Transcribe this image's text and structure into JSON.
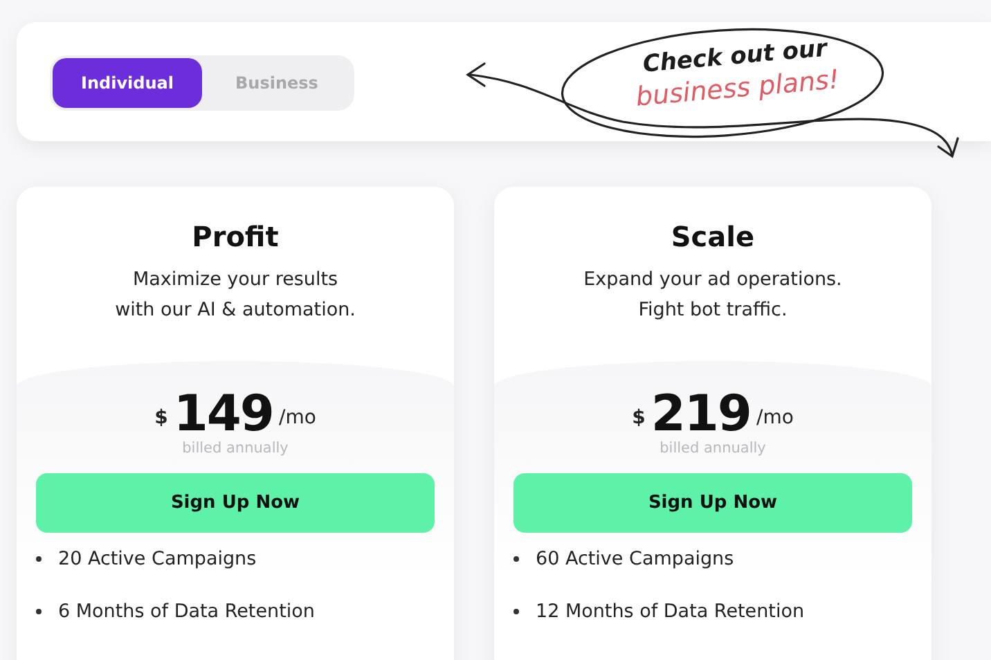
{
  "plan_toggle": [
    {
      "label": "Individual",
      "selected": true
    },
    {
      "label": "Business",
      "selected": false
    }
  ],
  "callout": {
    "line_1": "Check out our",
    "line_2": "business plans!"
  },
  "plans": [
    {
      "name": "Profit",
      "description": [
        "Maximize your results",
        "with our AI & automation."
      ],
      "currency": "$",
      "price": "149",
      "period": "/mo",
      "billing": "billed annually",
      "button": "Sign Up Now",
      "features": [
        "20 Active Campaigns",
        "6 Months of Data Retention"
      ]
    },
    {
      "name": "Scale",
      "description": [
        "Expand your ad operations.",
        "Fight bot traffic."
      ],
      "currency": "$",
      "price": "219",
      "period": "/mo",
      "billing": "billed annually",
      "button": "Sign Up Now",
      "features": [
        "60 Active Campaigns",
        "12 Months of Data Retention"
      ]
    }
  ]
}
